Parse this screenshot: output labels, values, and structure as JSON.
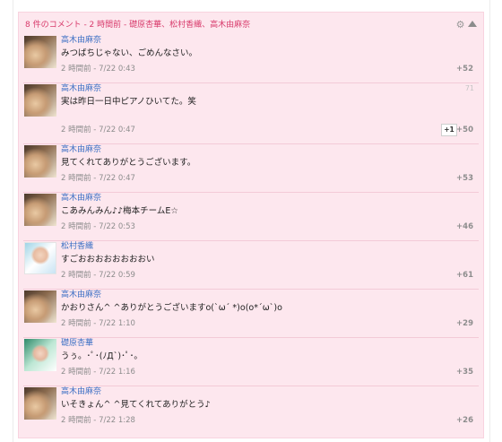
{
  "panel": {
    "title": "8 件のコメント - 2 時間前 - 礎原杏華、松村香織、高木由麻奈",
    "gear_icon": "gear-icon",
    "collapse_icon": "triangle-up-icon"
  },
  "comments": [
    {
      "author": "高木由麻奈",
      "text": "みつばちじゃない、ごめんなさい。",
      "meta": "2 時間前 - 7/22 0:43",
      "score": "+52",
      "avatar": "avatar-takagi"
    },
    {
      "author": "高木由麻奈",
      "text": "実は昨日一日中ピアノひいてた。笑",
      "meta": "2 時間前 - 7/22 0:47",
      "score": "+50",
      "number": "71",
      "plus_one": "+1",
      "avatar": "avatar-takagi"
    },
    {
      "author": "高木由麻奈",
      "text": "見てくれてありがとうございます。",
      "meta": "2 時間前 - 7/22 0:47",
      "score": "+53",
      "avatar": "avatar-takagi"
    },
    {
      "author": "高木由麻奈",
      "text": "こあみんみん♪♪梅本チームE☆",
      "meta": "2 時間前 - 7/22 0:53",
      "score": "+46",
      "avatar": "avatar-takagi"
    },
    {
      "author": "松村香織",
      "text": "すごおおおおおおおおい",
      "meta": "2 時間前 - 7/22 0:59",
      "score": "+61",
      "avatar": "avatar-matsumura"
    },
    {
      "author": "高木由麻奈",
      "text": "かおりさん^ ^ありがとうございますo(`ω´ *)o(o*´ω`)o",
      "meta": "2 時間前 - 7/22 1:10",
      "score": "+29",
      "avatar": "avatar-takagi"
    },
    {
      "author": "礎原杏華",
      "text": "うぅ。･ﾟ･(ﾉД`)･ﾟ･。",
      "meta": "2 時間前 - 7/22 1:16",
      "score": "+35",
      "avatar": "avatar-isohara"
    },
    {
      "author": "高木由麻奈",
      "text": "いそきょん^ ^見てくれてありがとう♪",
      "meta": "2 時間前 - 7/22 1:28",
      "score": "+26",
      "avatar": "avatar-takagi"
    }
  ]
}
